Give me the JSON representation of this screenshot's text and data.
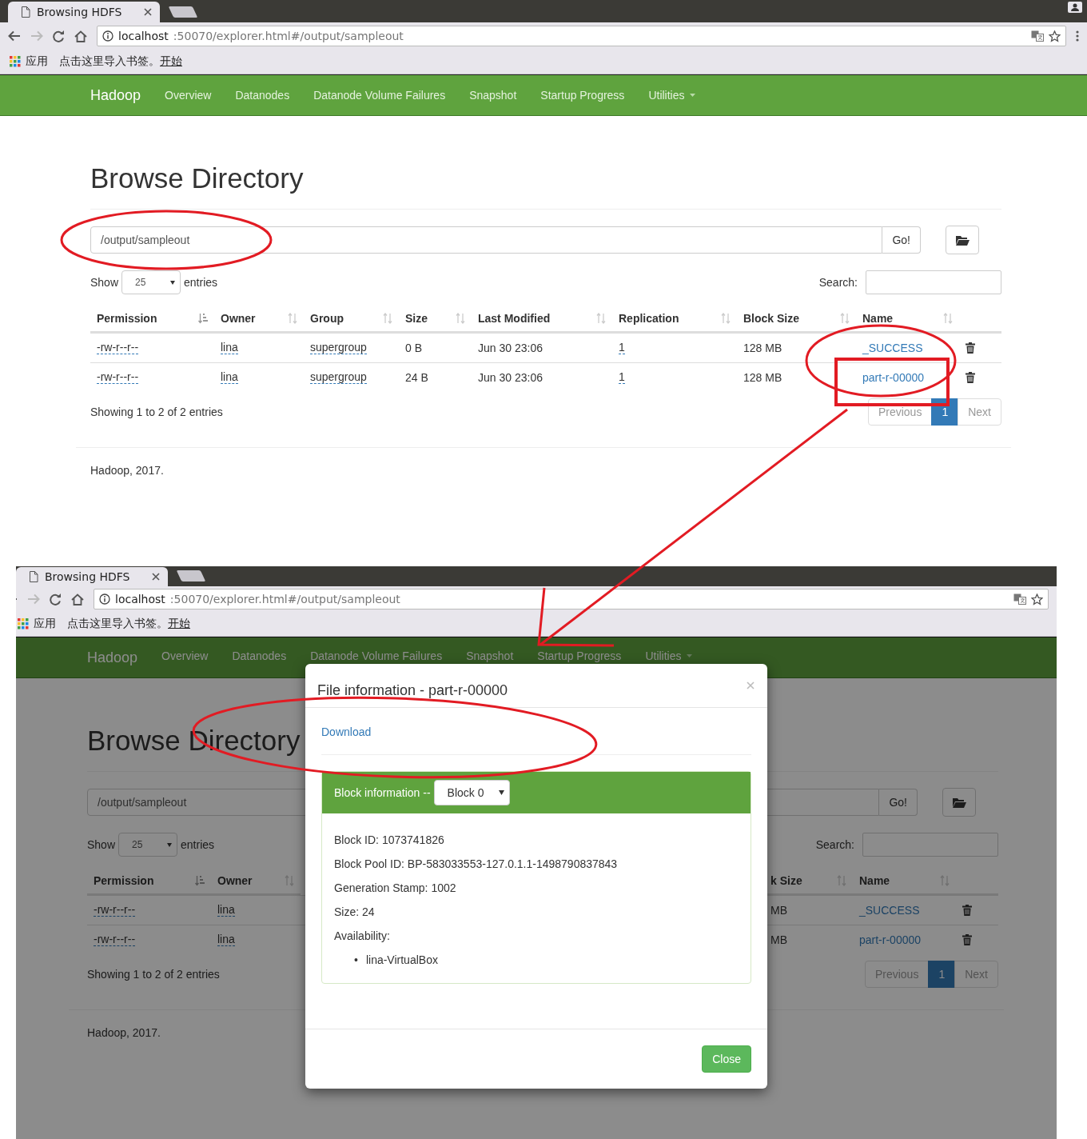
{
  "windows": [
    {
      "browser": {
        "tab_title": "Browsing HDFS",
        "url_host": "localhost",
        "url_rest": ":50070/explorer.html#/output/sampleout",
        "bookmarks": {
          "apps": "应用",
          "prompt": "点击这里导入书签。",
          "link": "开始"
        }
      },
      "navbar": {
        "brand": "Hadoop",
        "items": [
          {
            "label": "Overview",
            "dropdown": false
          },
          {
            "label": "Datanodes",
            "dropdown": false
          },
          {
            "label": "Datanode Volume Failures",
            "dropdown": false
          },
          {
            "label": "Snapshot",
            "dropdown": false
          },
          {
            "label": "Startup Progress",
            "dropdown": false
          },
          {
            "label": "Utilities",
            "dropdown": true
          }
        ]
      },
      "page": {
        "heading": "Browse Directory",
        "path": "/output/sampleout",
        "go": "Go!",
        "show": "Show",
        "page_size": "25",
        "entries": "entries",
        "search": "Search:",
        "columns": [
          {
            "kind": "permission",
            "label": "Permission",
            "sorted": true
          },
          {
            "kind": "owner",
            "label": "Owner",
            "sorted": false
          },
          {
            "kind": "group",
            "label": "Group",
            "sorted": false
          },
          {
            "kind": "size",
            "label": "Size",
            "sorted": false
          },
          {
            "kind": "modified",
            "label": "Last Modified",
            "sorted": false
          },
          {
            "kind": "replication",
            "label": "Replication",
            "sorted": false
          },
          {
            "kind": "block_size",
            "label": "Block Size",
            "sorted": false
          },
          {
            "kind": "name",
            "label": "Name",
            "sorted": false
          }
        ],
        "rows": [
          {
            "cells": {
              "permission": "-rw-r--r--",
              "owner": "lina",
              "group": "supergroup",
              "size": "0 B",
              "modified": "Jun 30 23:06",
              "replication": "1",
              "block_size": "128 MB",
              "name": "_SUCCESS"
            }
          },
          {
            "cells": {
              "permission": "-rw-r--r--",
              "owner": "lina",
              "group": "supergroup",
              "size": "24 B",
              "modified": "Jun 30 23:06",
              "replication": "1",
              "block_size": "128 MB",
              "name": "part-r-00000"
            }
          }
        ],
        "info": "Showing 1 to 2 of 2 entries",
        "pagination": [
          {
            "label": "Previous",
            "selected": false,
            "disabled": true
          },
          {
            "label": "1",
            "selected": true,
            "disabled": false
          },
          {
            "label": "Next",
            "selected": false,
            "disabled": true
          }
        ],
        "footer": "Hadoop, 2017."
      }
    },
    {
      "browser": {
        "tab_title": "Browsing HDFS",
        "url_host": "localhost",
        "url_rest": ":50070/explorer.html#/output/sampleout",
        "bookmarks": {
          "apps": "应用",
          "prompt": "点击这里导入书签。",
          "link": "开始"
        }
      },
      "navbar": {
        "brand": "Hadoop",
        "items": [
          {
            "label": "Overview",
            "dropdown": false
          },
          {
            "label": "Datanodes",
            "dropdown": false
          },
          {
            "label": "Datanode Volume Failures",
            "dropdown": false
          },
          {
            "label": "Snapshot",
            "dropdown": false
          },
          {
            "label": "Startup Progress",
            "dropdown": false
          },
          {
            "label": "Utilities",
            "dropdown": true
          }
        ]
      },
      "page": {
        "heading": "Browse Directory",
        "path": "/output/sampleout",
        "go": "Go!",
        "show": "Show",
        "page_size": "25",
        "entries": "entries",
        "search": "Search:",
        "columns": [
          {
            "kind": "permission",
            "label": "Permission",
            "sorted": true
          },
          {
            "kind": "owner",
            "label": "Owner",
            "sorted": false
          },
          {
            "kind": "block_size",
            "label": "k Size",
            "sorted": false
          },
          {
            "kind": "name",
            "label": "Name",
            "sorted": false
          }
        ],
        "rows": [
          {
            "cells": {
              "permission": "-rw-r--r--",
              "owner": "lina",
              "block_size": "MB",
              "name": "_SUCCESS"
            }
          },
          {
            "cells": {
              "permission": "-rw-r--r--",
              "owner": "lina",
              "block_size": "MB",
              "name": "part-r-00000"
            }
          }
        ],
        "info": "Showing 1 to 2 of 2 entries",
        "pagination": [
          {
            "label": "Previous",
            "selected": false,
            "disabled": true
          },
          {
            "label": "1",
            "selected": true,
            "disabled": false
          },
          {
            "label": "Next",
            "selected": false,
            "disabled": true
          }
        ],
        "footer": "Hadoop, 2017."
      },
      "modal": {
        "title": "File information - part-r-00000",
        "download": "Download",
        "panel_label": "Block information --",
        "block_select": "Block 0",
        "lines": [
          "Block ID: 1073741826",
          "Block Pool ID: BP-583033553-127.0.1.1-1498790837843",
          "Generation Stamp: 1002",
          "Size: 24",
          "Availability:"
        ],
        "host_bullet": "•",
        "hosts": [
          "lina-VirtualBox"
        ],
        "close": "Close"
      }
    }
  ]
}
